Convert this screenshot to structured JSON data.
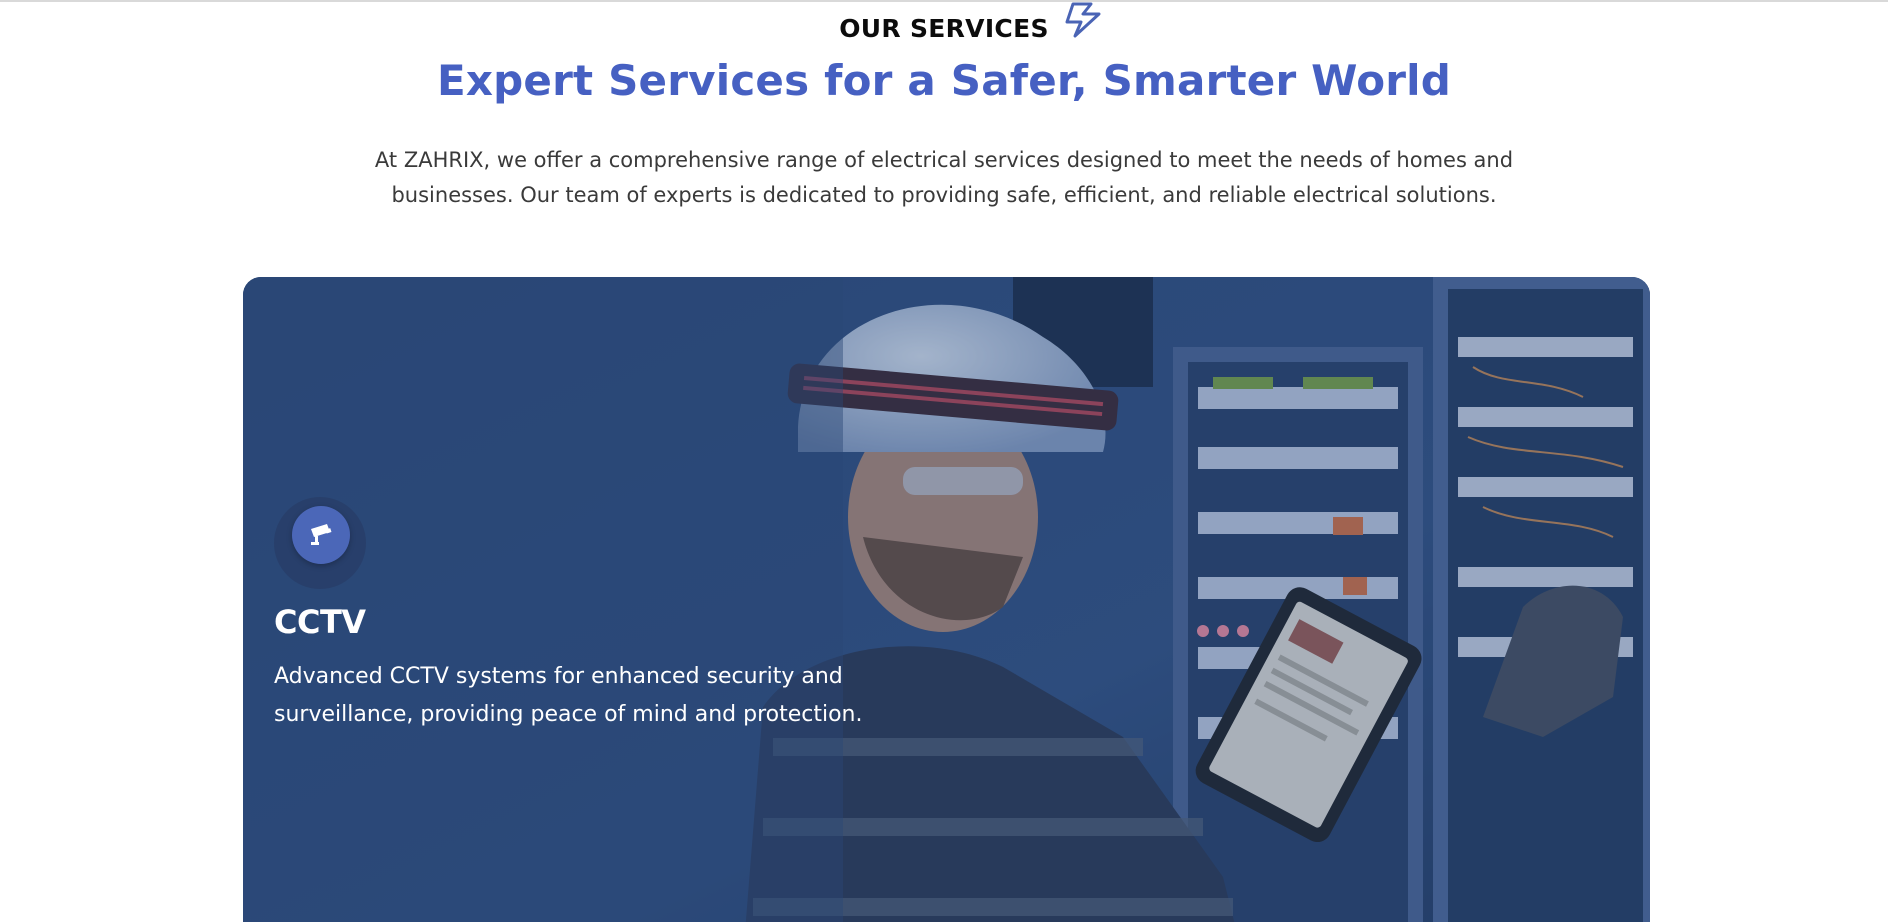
{
  "section": {
    "eyebrow": "OUR SERVICES",
    "eyebrow_icon": "lightning-bolt-icon",
    "headline": "Expert Services for a Safer, Smarter World",
    "intro": "At ZAHRIX, we offer a comprehensive range of electrical services designed to meet the needs of homes and businesses. Our team of experts is dedicated to providing safe, efficient, and reliable electrical solutions."
  },
  "service_card": {
    "icon": "cctv-camera-icon",
    "title": "CCTV",
    "description": "Advanced CCTV systems for enhanced security and surveillance, providing peace of mind and protection."
  },
  "colors": {
    "accent": "#4660c2",
    "heading_text": "#0c0c0c",
    "body_text": "#3a3a3a",
    "card_overlay": "#2b4a7a",
    "icon_circle": "#4b67b8"
  }
}
